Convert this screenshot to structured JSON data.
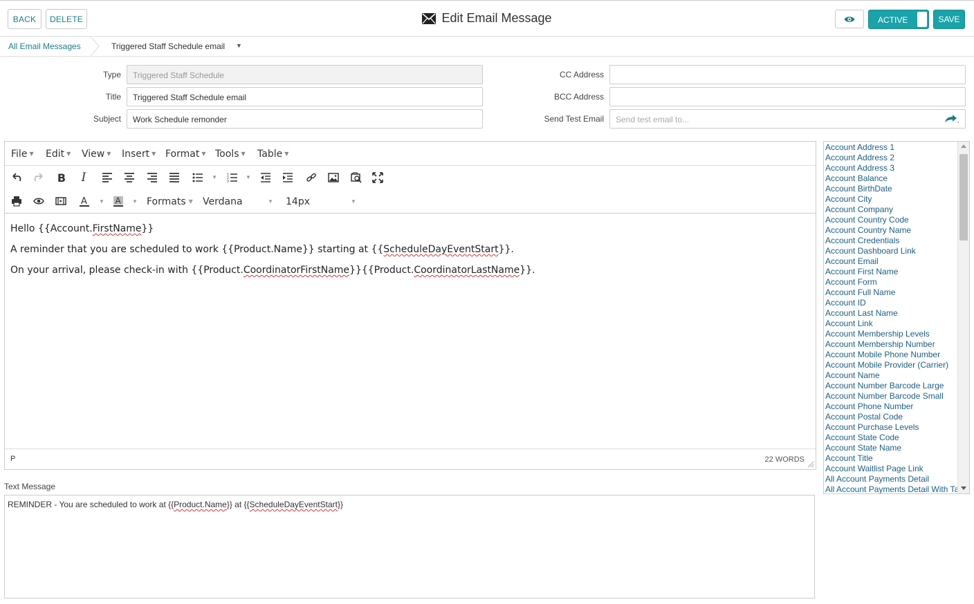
{
  "header": {
    "back_label": "BACK",
    "delete_label": "DELETE",
    "title": "Edit Email Message",
    "active_label": "ACTIVE",
    "save_label": "SAVE"
  },
  "breadcrumb": {
    "parent": "All Email Messages",
    "current": "Triggered Staff Schedule email"
  },
  "form": {
    "type_label": "Type",
    "type_value": "Triggered Staff Schedule",
    "title_label": "Title",
    "title_value": "Triggered Staff Schedule email",
    "subject_label": "Subject",
    "subject_value": "Work Schedule remonder",
    "cc_label": "CC Address",
    "cc_value": "",
    "bcc_label": "BCC Address",
    "bcc_value": "",
    "send_test_label": "Send Test Email",
    "send_test_placeholder": "Send test email to..."
  },
  "editor": {
    "menus": [
      "File",
      "Edit",
      "View",
      "Insert",
      "Format",
      "Tools",
      "Table"
    ],
    "formats_label": "Formats",
    "font_family": "Verdana",
    "font_size": "14px",
    "lines": {
      "l1_a": "Hello {{Account.",
      "l1_b": "FirstName",
      "l1_c": "}}",
      "l2_a": "A reminder that you are scheduled to work {{Product.Name}} starting at {{",
      "l2_b": "ScheduleDayEventStart",
      "l2_c": "}}.",
      "l3_a": "On your arrival, please check-in with {{Product.",
      "l3_b": "CoordinatorFirstName",
      "l3_c": "}}{{Product.",
      "l3_d": "CoordinatorLastName",
      "l3_e": "}}."
    },
    "status_path": "P",
    "word_count": "22 WORDS"
  },
  "fields": [
    "Account Address 1",
    "Account Address 2",
    "Account Address 3",
    "Account Balance",
    "Account BirthDate",
    "Account City",
    "Account Company",
    "Account Country Code",
    "Account Country Name",
    "Account Credentials",
    "Account Dashboard Link",
    "Account Email",
    "Account First Name",
    "Account Form",
    "Account Full Name",
    "Account ID",
    "Account Last Name",
    "Account Link",
    "Account Membership Levels",
    "Account Membership Number",
    "Account Mobile Phone Number",
    "Account Mobile Provider (Carrier)",
    "Account Name",
    "Account Number Barcode Large",
    "Account Number Barcode Small",
    "Account Phone Number",
    "Account Postal Code",
    "Account Purchase Levels",
    "Account State Code",
    "Account State Name",
    "Account Title",
    "Account Waitlist Page Link",
    "All Account Payments Detail",
    "All Account Payments Detail With Ta"
  ],
  "text_message": {
    "label": "Text Message",
    "part_a": "REMINDER - You are scheduled to work at {{",
    "part_b": "Product.Name",
    "part_c": "}} at {{",
    "part_d": "ScheduleDayEventStart",
    "part_e": "}}"
  },
  "colors": {
    "accent": "#1aa3a9",
    "link": "#1a7f86"
  }
}
